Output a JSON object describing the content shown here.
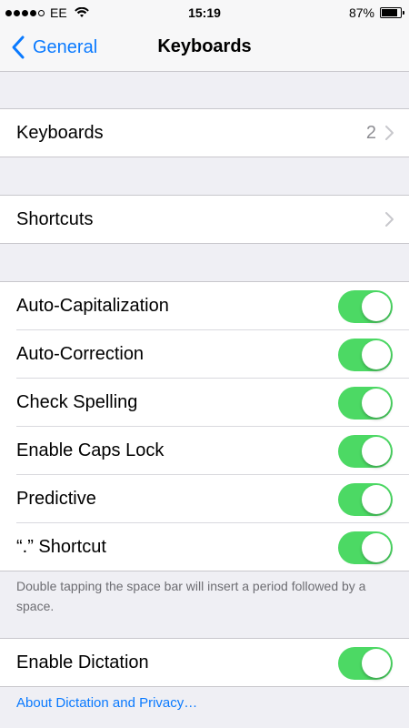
{
  "status_bar": {
    "carrier": "EE",
    "time": "15:19",
    "battery_percent": "87%",
    "battery_level": 0.87,
    "signal_dots_filled": 4,
    "signal_dots_total": 5
  },
  "nav": {
    "back_label": "General",
    "title": "Keyboards"
  },
  "groups": {
    "keyboards": {
      "label": "Keyboards",
      "value": "2"
    },
    "shortcuts": {
      "label": "Shortcuts"
    },
    "toggles": [
      {
        "label": "Auto-Capitalization",
        "on": true
      },
      {
        "label": "Auto-Correction",
        "on": true
      },
      {
        "label": "Check Spelling",
        "on": true
      },
      {
        "label": "Enable Caps Lock",
        "on": true
      },
      {
        "label": "Predictive",
        "on": true
      },
      {
        "label": "“.” Shortcut",
        "on": true
      }
    ],
    "shortcut_note": "Double tapping the space bar will insert a period followed by a space.",
    "dictation": {
      "label": "Enable Dictation",
      "on": true
    },
    "dictation_link": "About Dictation and Privacy…"
  },
  "colors": {
    "accent": "#0a7aff",
    "toggle_on": "#4cd964",
    "background": "#efeff4"
  }
}
